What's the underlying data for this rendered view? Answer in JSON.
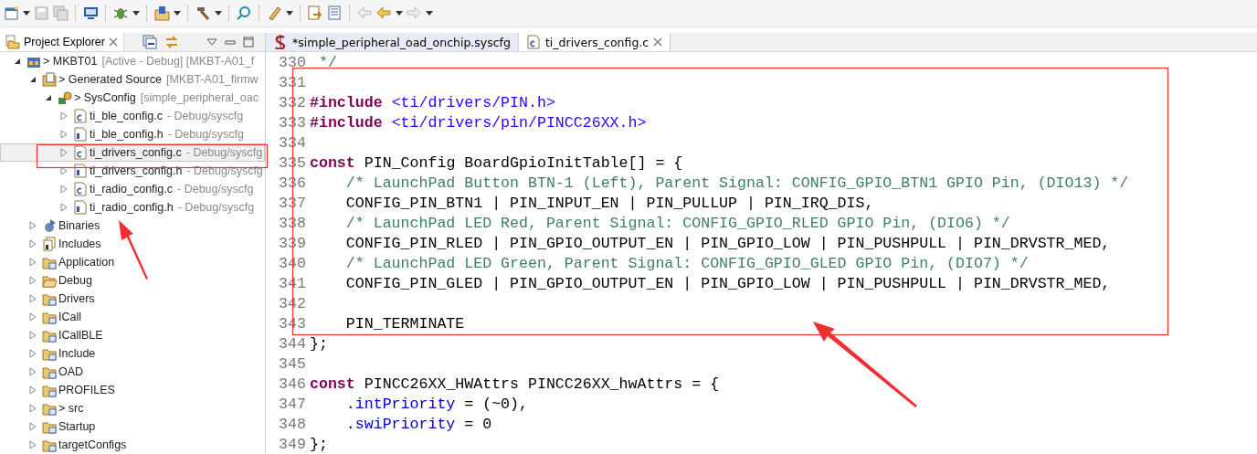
{
  "explorer": {
    "title": "Project Explorer",
    "tree": [
      {
        "label": "> MKBT01",
        "decoration": "[Active - Debug] [MKBT-A01_f",
        "kind": "project",
        "expanded": true,
        "selected": false,
        "children": [
          {
            "label": "> Generated Source",
            "decoration": "[MKBT-A01_firmw",
            "kind": "generated",
            "expanded": true,
            "selected": false,
            "children": [
              {
                "label": "> SysConfig",
                "decoration": "[simple_peripheral_oac",
                "kind": "sysconfig",
                "expanded": true,
                "selected": false,
                "children": [
                  {
                    "label": "ti_ble_config.c",
                    "decoration": "- Debug/syscfg",
                    "kind": "cfile",
                    "expanded": false,
                    "selected": false
                  },
                  {
                    "label": "ti_ble_config.h",
                    "decoration": "- Debug/syscfg",
                    "kind": "hfile",
                    "expanded": false,
                    "selected": false
                  },
                  {
                    "label": "ti_drivers_config.c",
                    "decoration": "- Debug/syscfg",
                    "kind": "cfile",
                    "expanded": false,
                    "selected": true
                  },
                  {
                    "label": "ti_drivers_config.h",
                    "decoration": "- Debug/syscfg",
                    "kind": "hfile",
                    "expanded": false,
                    "selected": false
                  },
                  {
                    "label": "ti_radio_config.c",
                    "decoration": "- Debug/syscfg",
                    "kind": "cfile",
                    "expanded": false,
                    "selected": false
                  },
                  {
                    "label": "ti_radio_config.h",
                    "decoration": "- Debug/syscfg",
                    "kind": "hfile",
                    "expanded": false,
                    "selected": false
                  }
                ]
              }
            ]
          },
          {
            "label": "Binaries",
            "kind": "binaries",
            "expanded": false,
            "selected": false
          },
          {
            "label": "Includes",
            "kind": "includes",
            "expanded": false,
            "selected": false
          },
          {
            "label": "Application",
            "kind": "folder",
            "expanded": false,
            "selected": false
          },
          {
            "label": "Debug",
            "kind": "openfolder",
            "expanded": false,
            "selected": false
          },
          {
            "label": "Drivers",
            "kind": "folder",
            "expanded": false,
            "selected": false
          },
          {
            "label": "ICall",
            "kind": "folder",
            "expanded": false,
            "selected": false
          },
          {
            "label": "ICallBLE",
            "kind": "folder",
            "expanded": false,
            "selected": false
          },
          {
            "label": "Include",
            "kind": "folder",
            "expanded": false,
            "selected": false
          },
          {
            "label": "OAD",
            "kind": "folder",
            "expanded": false,
            "selected": false
          },
          {
            "label": "PROFILES",
            "kind": "folder",
            "expanded": false,
            "selected": false
          },
          {
            "label": "> src",
            "kind": "folder",
            "expanded": false,
            "selected": false
          },
          {
            "label": "Startup",
            "kind": "folder",
            "expanded": false,
            "selected": false
          },
          {
            "label": "targetConfigs",
            "kind": "folder",
            "expanded": false,
            "selected": false
          }
        ]
      }
    ]
  },
  "editor_tabs": [
    {
      "label": "*simple_peripheral_oad_onchip.syscfg",
      "kind": "syscfg",
      "selected": false
    },
    {
      "label": "ti_drivers_config.c",
      "kind": "cfile",
      "selected": true
    }
  ],
  "code": [
    {
      "number": "330",
      "tokens": [
        {
          "kind": "comment",
          "text": " */"
        }
      ]
    },
    {
      "number": "331"
    },
    {
      "number": "332",
      "tokens": [
        {
          "kind": "keyword",
          "text": "#include"
        },
        {
          "kind": "string",
          "text": " <ti/drivers/PIN.h>"
        }
      ]
    },
    {
      "number": "333",
      "tokens": [
        {
          "kind": "keyword",
          "text": "#include"
        },
        {
          "kind": "string",
          "text": " <ti/drivers/pin/PINCC26XX.h>"
        }
      ]
    },
    {
      "number": "334"
    },
    {
      "number": "335",
      "tokens": [
        {
          "kind": "keyword",
          "text": "const"
        },
        {
          "kind": "plain",
          "text": " PIN_Config BoardGpioInitTable[] = {"
        }
      ]
    },
    {
      "number": "336",
      "tokens": [
        {
          "kind": "comment",
          "text": "    /* LaunchPad Button BTN-1 (Left), Parent Signal: CONFIG_GPIO_BTN1 GPIO Pin, (DIO13) */"
        }
      ]
    },
    {
      "number": "337",
      "tokens": [
        {
          "kind": "plain",
          "text": "    CONFIG_PIN_BTN1 | PIN_INPUT_EN | PIN_PULLUP | PIN_IRQ_DIS,"
        }
      ]
    },
    {
      "number": "338",
      "tokens": [
        {
          "kind": "comment",
          "text": "    /* LaunchPad LED Red, Parent Signal: CONFIG_GPIO_RLED GPIO Pin, (DIO6) */"
        }
      ]
    },
    {
      "number": "339",
      "tokens": [
        {
          "kind": "plain",
          "text": "    CONFIG_PIN_RLED | PIN_GPIO_OUTPUT_EN | PIN_GPIO_LOW | PIN_PUSHPULL | PIN_DRVSTR_MED,"
        }
      ]
    },
    {
      "number": "340",
      "tokens": [
        {
          "kind": "comment",
          "text": "    /* LaunchPad LED Green, Parent Signal: CONFIG_GPIO_GLED GPIO Pin, (DIO7) */"
        }
      ]
    },
    {
      "number": "341",
      "tokens": [
        {
          "kind": "plain",
          "text": "    CONFIG_PIN_GLED | PIN_GPIO_OUTPUT_EN | PIN_GPIO_LOW | PIN_PUSHPULL | PIN_DRVSTR_MED,"
        }
      ]
    },
    {
      "number": "342"
    },
    {
      "number": "343",
      "tokens": [
        {
          "kind": "plain",
          "text": "    PIN_TERMINATE"
        }
      ]
    },
    {
      "number": "344",
      "tokens": [
        {
          "kind": "plain",
          "text": "};"
        }
      ]
    },
    {
      "number": "345"
    },
    {
      "number": "346",
      "tokens": [
        {
          "kind": "keyword",
          "text": "const"
        },
        {
          "kind": "plain",
          "text": " PINCC26XX_HWAttrs PINCC26XX_hwAttrs = {"
        }
      ]
    },
    {
      "number": "347",
      "tokens": [
        {
          "kind": "field",
          "text": "    .intPriority"
        },
        {
          "kind": "plain",
          "text": " = (~0),"
        }
      ]
    },
    {
      "number": "348",
      "tokens": [
        {
          "kind": "field",
          "text": "    .swiPriority"
        },
        {
          "kind": "plain",
          "text": " = 0"
        }
      ]
    },
    {
      "number": "349",
      "tokens": [
        {
          "kind": "plain",
          "text": "};"
        }
      ]
    }
  ]
}
